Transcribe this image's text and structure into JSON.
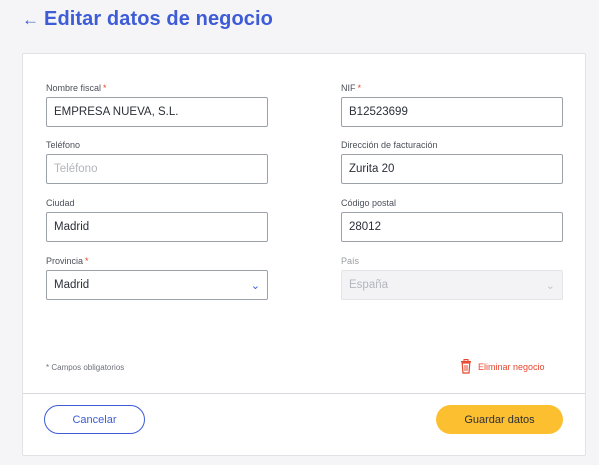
{
  "header": {
    "back_icon": "arrow-left-icon",
    "title": "Editar datos de negocio"
  },
  "colors": {
    "accent": "#3d5cd6",
    "required": "#e4472e",
    "primary_button": "#fcbf2f"
  },
  "form": {
    "nombre_fiscal": {
      "label": "Nombre fiscal",
      "required_mark": "*",
      "value": "EMPRESA NUEVA, S.L."
    },
    "nif": {
      "label": "NIF",
      "required_mark": "*",
      "value": "B12523699"
    },
    "telefono": {
      "label": "Teléfono",
      "placeholder": "Teléfono",
      "value": ""
    },
    "direccion": {
      "label": "Dirección de facturación",
      "value": "Zurita 20"
    },
    "ciudad": {
      "label": "Ciudad",
      "value": "Madrid"
    },
    "codigo_postal": {
      "label": "Código postal",
      "value": "28012"
    },
    "provincia": {
      "label": "Provincia",
      "required_mark": "*",
      "selected": "Madrid",
      "icon": "chevron-down-icon"
    },
    "pais": {
      "label": "País",
      "selected": "España",
      "disabled": true,
      "icon": "chevron-down-icon"
    }
  },
  "footnote": "* Campos obligatorios",
  "delete": {
    "label": "Eliminar negocio",
    "icon": "trash-icon"
  },
  "buttons": {
    "cancel": "Cancelar",
    "save": "Guardar datos"
  }
}
